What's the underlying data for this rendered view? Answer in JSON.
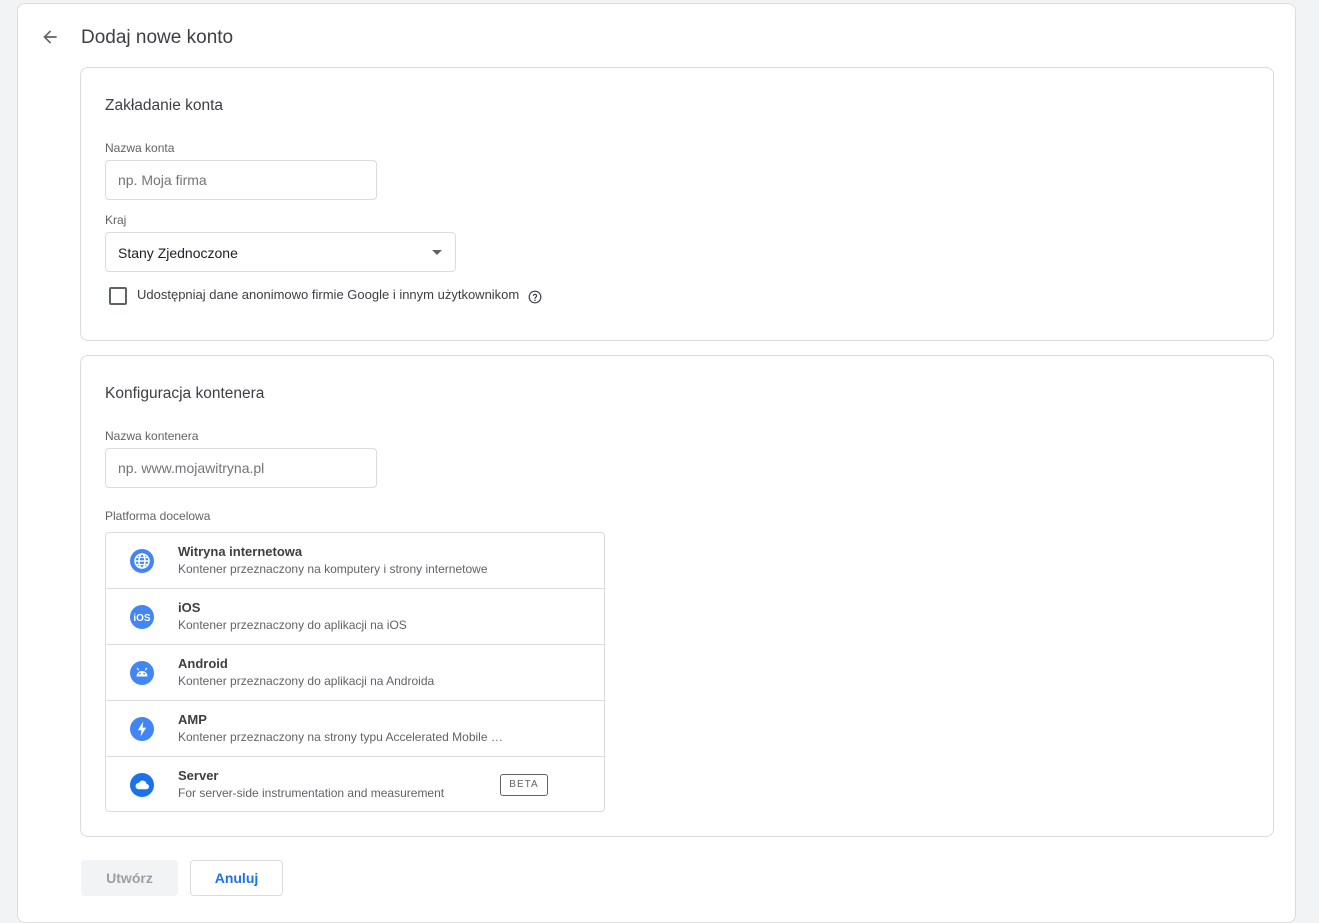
{
  "header": {
    "title": "Dodaj nowe konto",
    "back_icon": "arrow-back-icon"
  },
  "account_setup": {
    "title": "Zakładanie konta",
    "account_name": {
      "label": "Nazwa konta",
      "value": "",
      "placeholder": "np. Moja firma"
    },
    "country": {
      "label": "Kraj",
      "selected": "Stany Zjednoczone"
    },
    "share_data": {
      "checked": false,
      "label": "Udostępniaj dane anonimowo firmie Google i innym użytkownikom",
      "help_icon": "help-circle-icon"
    }
  },
  "container_setup": {
    "title": "Konfiguracja kontenera",
    "container_name": {
      "label": "Nazwa kontenera",
      "value": "",
      "placeholder": "np. www.mojawitryna.pl"
    },
    "platform_label": "Platforma docelowa",
    "platforms": [
      {
        "name": "Witryna internetowa",
        "description": "Kontener przeznaczony na komputery i strony internetowe",
        "icon": "globe-icon"
      },
      {
        "name": "iOS",
        "description": "Kontener przeznaczony do aplikacji na iOS",
        "icon": "ios-icon"
      },
      {
        "name": "Android",
        "description": "Kontener przeznaczony do aplikacji na Androida",
        "icon": "android-icon"
      },
      {
        "name": "AMP",
        "description": "Kontener przeznaczony na strony typu Accelerated Mobile Pages",
        "icon": "amp-bolt-icon"
      },
      {
        "name": "Server",
        "description": "For server-side instrumentation and measurement",
        "icon": "cloud-icon",
        "badge": "BETA"
      }
    ]
  },
  "actions": {
    "create_label": "Utwórz",
    "cancel_label": "Anuluj"
  },
  "colors": {
    "accent": "#1a73e8",
    "icon_blue": "#4285f4",
    "border": "#dadce0",
    "background": "#f1f3f4"
  }
}
